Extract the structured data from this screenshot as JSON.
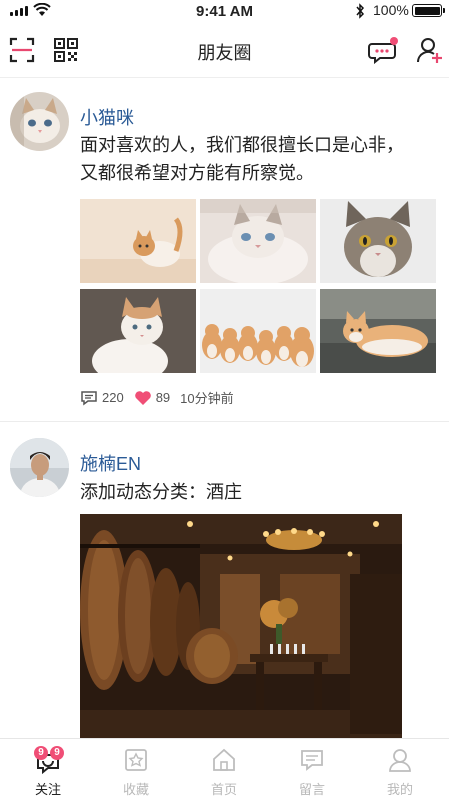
{
  "status_bar": {
    "time": "9:41 AM",
    "battery": "100%"
  },
  "header": {
    "title": "朋友圈"
  },
  "posts": [
    {
      "username": "小猫咪",
      "text": [
        "面对喜欢的人，我们都很擅长口是心非，",
        "又都很希望对方能有所察觉。"
      ],
      "comments": "220",
      "likes": "89",
      "time": "10分钟前"
    },
    {
      "username": "施楠EN",
      "text": [
        "添加动态分类：酒庄"
      ]
    }
  ],
  "tabs": [
    {
      "label": "关注",
      "badge_left": "9",
      "badge_right": "9"
    },
    {
      "label": "收藏"
    },
    {
      "label": "首页"
    },
    {
      "label": "留言"
    },
    {
      "label": "我的"
    }
  ],
  "colors": {
    "accent": "#f04e76",
    "username": "#2a5a96"
  }
}
